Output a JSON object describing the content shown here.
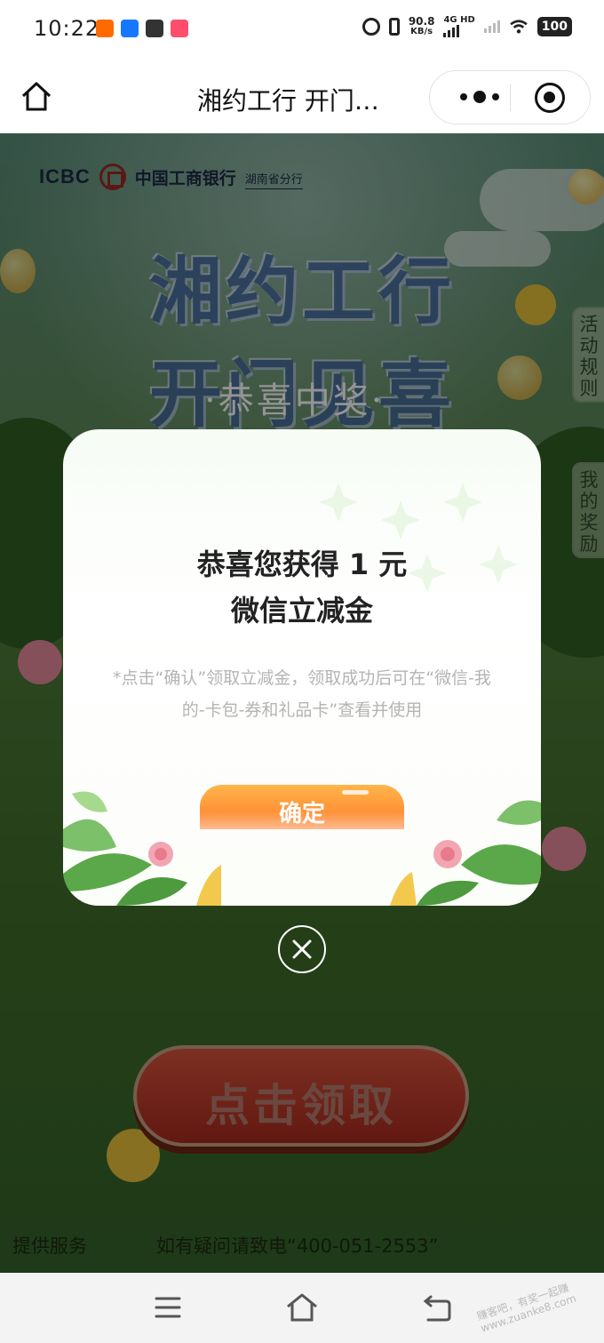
{
  "status_bar": {
    "time": "10:22",
    "speed_value": "90.8",
    "speed_unit": "KB/s",
    "network": "4G HD",
    "battery": "100"
  },
  "nav": {
    "title": "湘约工行 开门…"
  },
  "scene": {
    "bank_latin": "ICBC",
    "bank_name": "中国工商银行",
    "branch": "湖南省分行",
    "hero_line1": "湘约工行",
    "hero_line2": "开门见喜",
    "ribbon": "·恭喜中奖·",
    "tab_rules": "活动规则",
    "tab_rewards": "我的奖励",
    "claim_label": "点击领取",
    "footer_left": "提供服务",
    "footer_right": "如有疑问请致电“400-051-2553”"
  },
  "modal": {
    "title_line1": "恭喜您获得 1 元",
    "title_line2": "微信立减金",
    "note": "*点击“确认”领取立减金，领取成功后可在“微信-我的-卡包-券和礼品卡”查看并使用",
    "confirm_label": "确定"
  },
  "watermark": "赚客吧，有奖一起赚 www.zuanke8.com",
  "colors": {
    "accent_orange": "#ff7b2b",
    "icbc_red": "#9b2a23",
    "grass_green": "#4c7a38"
  }
}
